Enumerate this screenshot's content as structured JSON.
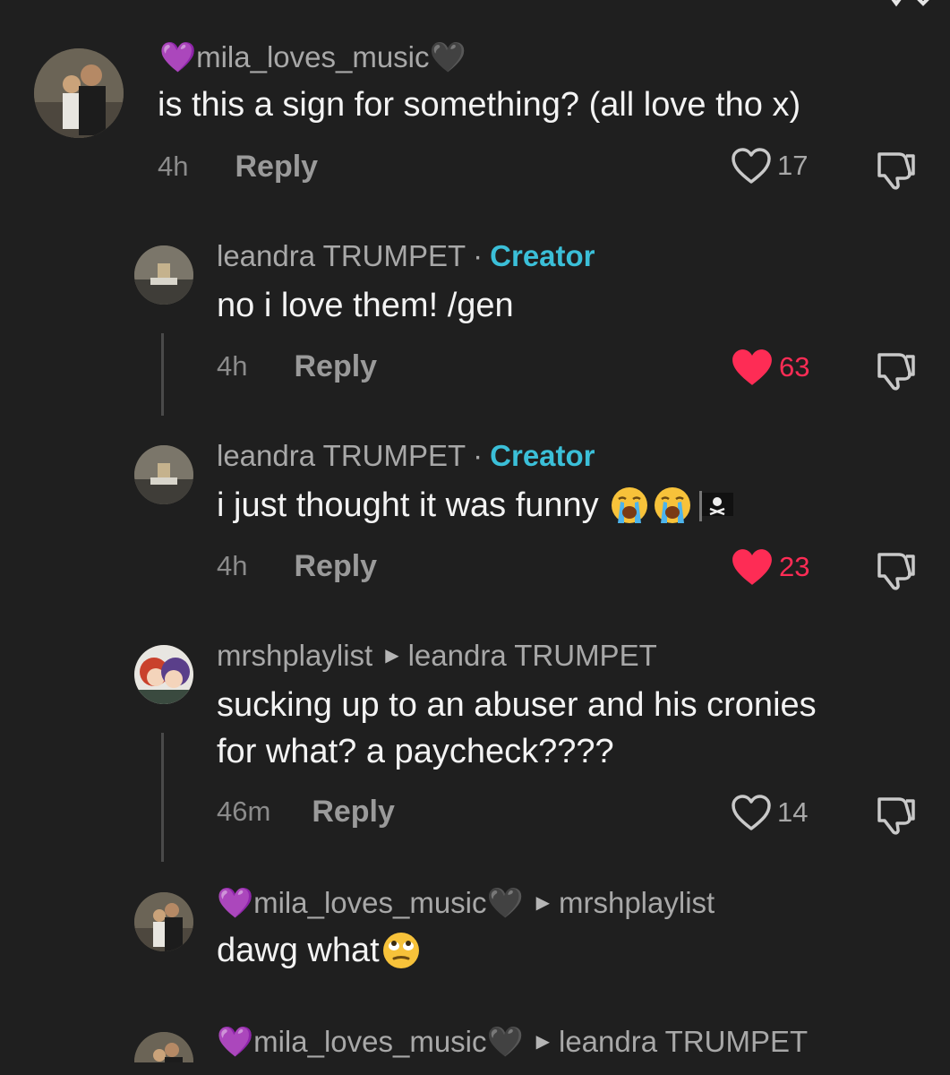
{
  "colors": {
    "background": "#1f1f1f",
    "creator": "#3bbfd8",
    "liked": "#fe2c55",
    "muted": "#a8a8a8"
  },
  "comments": [
    {
      "username": "💜mila_loves_music🖤",
      "text": "is this a sign for something? (all love tho x)",
      "time": "4h",
      "reply_label": "Reply",
      "likes": "17",
      "liked": false
    },
    {
      "username": "leandra TRUMPET",
      "separator": "·",
      "badge": "Creator",
      "text": "no i love them! /gen",
      "time": "4h",
      "reply_label": "Reply",
      "likes": "63",
      "liked": true
    },
    {
      "username": "leandra TRUMPET",
      "separator": "·",
      "badge": "Creator",
      "text": "i just thought it was funny",
      "emoji_icons": [
        "loudly-crying-face-icon",
        "loudly-crying-face-icon",
        "pirate-flag-icon"
      ],
      "time": "4h",
      "reply_label": "Reply",
      "likes": "23",
      "liked": true
    },
    {
      "username": "mrshplaylist",
      "reply_to": "leandra TRUMPET",
      "text_line1": "sucking up to an abuser and his cronies",
      "text_line2": "for what? a paycheck????",
      "time": "46m",
      "reply_label": "Reply",
      "likes": "14",
      "liked": false
    },
    {
      "username": "💜mila_loves_music🖤",
      "reply_to": "mrshplaylist",
      "text": "dawg what",
      "emoji_icons": [
        "face-with-rolling-eyes-icon"
      ]
    },
    {
      "username": "💜mila_loves_music🖤",
      "reply_to": "leandra TRUMPET"
    }
  ]
}
